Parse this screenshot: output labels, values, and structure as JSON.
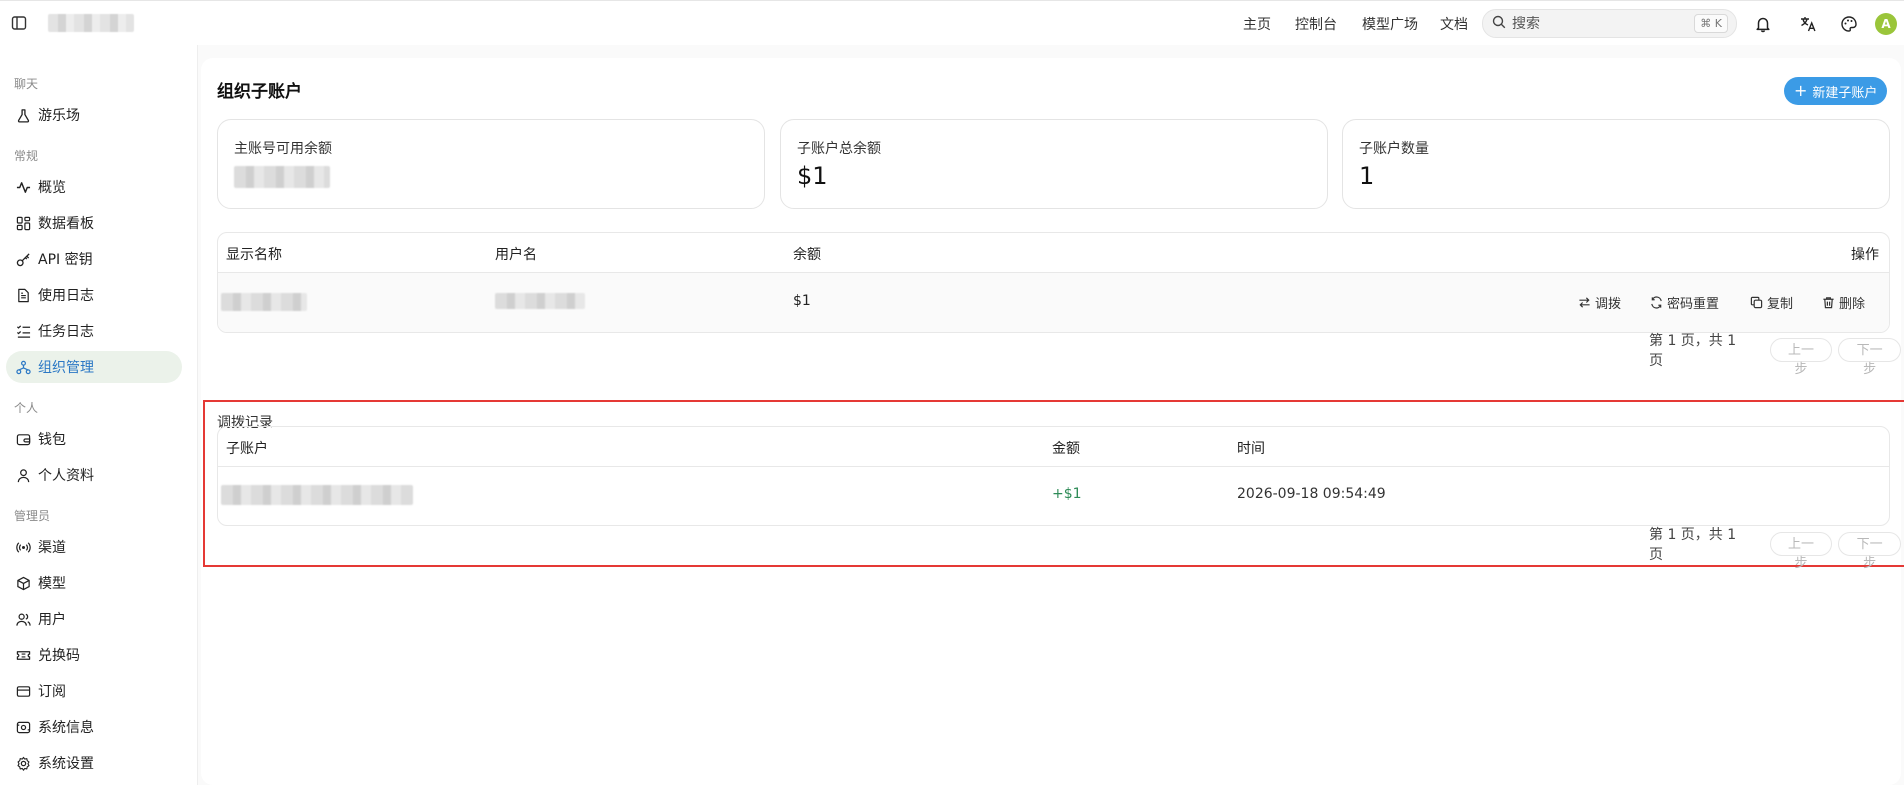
{
  "header": {
    "nav": [
      {
        "label": "主页"
      },
      {
        "label": "控制台"
      },
      {
        "label": "模型广场"
      },
      {
        "label": "文档"
      }
    ],
    "search": {
      "placeholder": "搜索",
      "shortcut": "⌘ K"
    },
    "avatar_letter": "A"
  },
  "sidebar": {
    "sections": [
      {
        "label": "聊天",
        "items": [
          {
            "label": "游乐场",
            "icon": "flask-icon"
          }
        ]
      },
      {
        "label": "常规",
        "items": [
          {
            "label": "概览",
            "icon": "activity-icon"
          },
          {
            "label": "数据看板",
            "icon": "dashboard-icon"
          },
          {
            "label": "API 密钥",
            "icon": "key-icon"
          },
          {
            "label": "使用日志",
            "icon": "file-text-icon"
          },
          {
            "label": "任务日志",
            "icon": "list-check-icon"
          },
          {
            "label": "组织管理",
            "icon": "org-icon",
            "active": true
          }
        ]
      },
      {
        "label": "个人",
        "items": [
          {
            "label": "钱包",
            "icon": "wallet-icon"
          },
          {
            "label": "个人资料",
            "icon": "user-icon"
          }
        ]
      },
      {
        "label": "管理员",
        "items": [
          {
            "label": "渠道",
            "icon": "radio-icon"
          },
          {
            "label": "模型",
            "icon": "box-icon"
          },
          {
            "label": "用户",
            "icon": "users-icon"
          },
          {
            "label": "兑换码",
            "icon": "ticket-icon"
          },
          {
            "label": "订阅",
            "icon": "credit-card-icon"
          },
          {
            "label": "系统信息",
            "icon": "info-icon"
          },
          {
            "label": "系统设置",
            "icon": "settings-icon"
          }
        ]
      }
    ]
  },
  "page": {
    "title": "组织子账户",
    "new_button": "新建子账户",
    "stats": [
      {
        "label": "主账号可用余额",
        "value": ""
      },
      {
        "label": "子账户总余额",
        "value": "$1"
      },
      {
        "label": "子账户数量",
        "value": "1"
      }
    ],
    "subaccounts_table": {
      "columns": [
        "显示名称",
        "用户名",
        "余额",
        "操作"
      ],
      "rows": [
        {
          "balance": "$1"
        }
      ],
      "actions": [
        "调拨",
        "密码重置",
        "复制",
        "删除"
      ],
      "pager": {
        "info": "第 1 页，共 1 页",
        "prev": "上一步",
        "next": "下一步"
      }
    },
    "transfer_records": {
      "title": "调拨记录",
      "columns": [
        "子账户",
        "金额",
        "时间"
      ],
      "rows": [
        {
          "amount": "+$1",
          "time": "2026-09-18 09:54:49"
        }
      ],
      "pager": {
        "info": "第 1 页，共 1 页",
        "prev": "上一步",
        "next": "下一步"
      }
    }
  },
  "colors": {
    "accent": "#3b9be6",
    "active_bg": "#ebf2ea",
    "active_text": "#2b78c5",
    "highlight_border": "#e53935",
    "positive_amount": "#2e8b57",
    "avatar": "#9ac53a"
  }
}
